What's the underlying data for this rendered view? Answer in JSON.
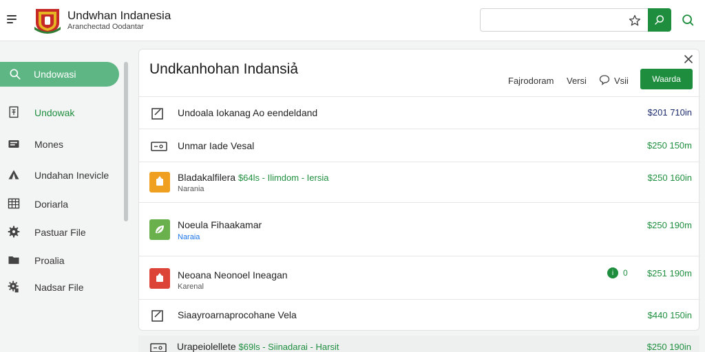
{
  "header": {
    "title": "Undwhan Indanesia",
    "subtitle": "Aranchectad Oodantar",
    "search_placeholder": "",
    "search_value": ""
  },
  "sidebar": {
    "items": [
      {
        "label": "Undowasi",
        "icon": "search-icon",
        "active": true
      },
      {
        "label": "Undowak",
        "icon": "document-icon",
        "green": true
      },
      {
        "label": "Mones",
        "icon": "wallet-icon"
      },
      {
        "label": "Undahan Inevicle",
        "icon": "tent-icon"
      },
      {
        "label": "Doriarla",
        "icon": "grid-table-icon"
      },
      {
        "label": "Pastuar File",
        "icon": "gear-icon"
      },
      {
        "label": "Proalia",
        "icon": "folder-icon"
      },
      {
        "label": "Nadsar File",
        "icon": "cog-file-icon"
      }
    ]
  },
  "card": {
    "title": "Undkanhohan Indansiả",
    "link_1": "Fajrodoram",
    "link_2": "Versi",
    "link_3": "Vsii",
    "button_label": "Waarda"
  },
  "rows": [
    {
      "title": "Undoala Iokanag Ao eendeldand",
      "tag": "",
      "sub": "",
      "price": "$201 710in"
    },
    {
      "title": "Unmar Iade Vesal",
      "tag": "",
      "sub": "",
      "price": "$250 150m"
    },
    {
      "title": "Bladakalfilera",
      "tag": "$64ls - Ilimdom - Iersia",
      "sub": "Narania",
      "price": "$250 160in"
    },
    {
      "title": "Noeula Fihaakamar",
      "tag": "",
      "sub": "Naraia",
      "price": "$250 190m"
    },
    {
      "title": "Neoana Neonoel Ineagan",
      "tag": "",
      "sub": "Karenal",
      "badge": "0",
      "price": "$251 190m"
    },
    {
      "title": "Siaayroarnaprocohane Vela",
      "tag": "",
      "sub": "",
      "price": "$440 150in"
    }
  ],
  "peek_row": {
    "title": "Urapeiolellete",
    "tag": "$69ls - Siinadarai - Harsit",
    "price": "$250 190in"
  },
  "colors": {
    "accent": "#1e8e3e",
    "sidebar_active": "#5fb685",
    "orange": "#f0a020",
    "green_tile": "#6ab04c",
    "red_tile": "#db4437"
  }
}
